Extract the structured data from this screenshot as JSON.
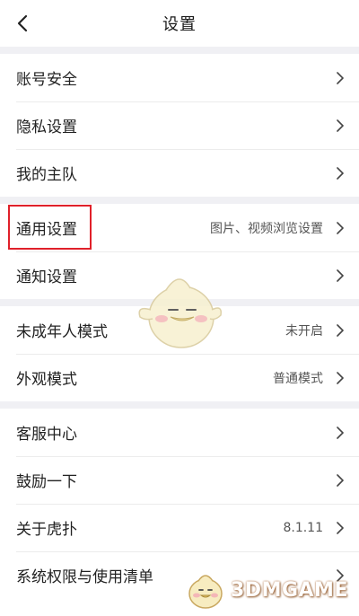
{
  "header": {
    "title": "设置"
  },
  "groups": [
    {
      "items": [
        {
          "label": "账号安全",
          "value": ""
        },
        {
          "label": "隐私设置",
          "value": ""
        },
        {
          "label": "我的主队",
          "value": ""
        }
      ]
    },
    {
      "items": [
        {
          "label": "通用设置",
          "value": "图片、视频浏览设置"
        },
        {
          "label": "通知设置",
          "value": ""
        }
      ]
    },
    {
      "items": [
        {
          "label": "未成年人模式",
          "value": "未开启"
        },
        {
          "label": "外观模式",
          "value": "普通模式"
        }
      ]
    },
    {
      "items": [
        {
          "label": "客服中心",
          "value": ""
        },
        {
          "label": "鼓励一下",
          "value": ""
        },
        {
          "label": "关于虎扑",
          "value": "8.1.11"
        },
        {
          "label": "系统权限与使用清单",
          "value": ""
        }
      ]
    }
  ],
  "watermark": {
    "text": "3DMGAME"
  },
  "colors": {
    "highlight": "#e0202a",
    "divider": "#ececec",
    "group_gap": "#f0f0f4"
  }
}
